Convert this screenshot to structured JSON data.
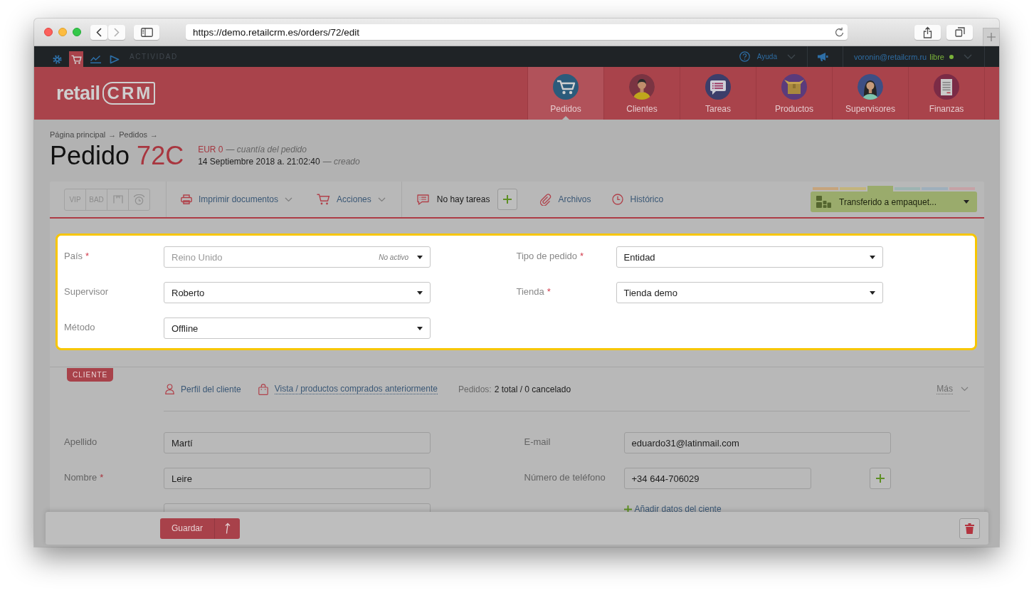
{
  "browser": {
    "url": "https://demo.retailcrm.es/orders/72/edit"
  },
  "topbar": {
    "tools": [
      {
        "kind": "settings",
        "selected": false
      },
      {
        "kind": "cart",
        "selected": true
      },
      {
        "kind": "chart",
        "selected": false
      },
      {
        "kind": "play",
        "selected": false
      }
    ],
    "activity": "ACTIVIDAD",
    "help": "Ayuda",
    "user": "voronin@retailcrm.ru",
    "user_status": "libre",
    "online": true
  },
  "logo": {
    "word": "retail",
    "mark": "CRM"
  },
  "nav": [
    {
      "kind": "cart",
      "label": "Pedidos",
      "selected": true
    },
    {
      "kind": "man",
      "label": "Clientes",
      "selected": false
    },
    {
      "kind": "tasks",
      "label": "Tareas",
      "selected": false
    },
    {
      "kind": "box",
      "label": "Productos",
      "selected": false
    },
    {
      "kind": "woman",
      "label": "Supervisores",
      "selected": false
    },
    {
      "kind": "ledger",
      "label": "Finanzas",
      "selected": false
    }
  ],
  "order": {
    "breadcrumb": {
      "items": [
        "Página principal",
        "Pedidos"
      ],
      "separator": "→"
    },
    "title": "Pedido",
    "number": "72C",
    "amount": "EUR 0",
    "amount_note": "— cuantía del pedido",
    "created": "14 Septiembre 2018 a. 21:02:40",
    "created_note": "— creado"
  },
  "toolbar": {
    "tags": [
      {
        "kind": "text",
        "label": "VIP"
      },
      {
        "kind": "text",
        "label": "BAD"
      },
      {
        "kind": "box"
      },
      {
        "kind": "alarm"
      }
    ],
    "actions": [
      {
        "kind": "print",
        "label": "Imprimir documentos"
      },
      {
        "kind": "cart",
        "label": "Acciones"
      }
    ],
    "tasks": "No hay tareas",
    "links": [
      {
        "kind": "clip",
        "label": "Archivos"
      },
      {
        "kind": "clock",
        "label": "Histórico"
      }
    ],
    "status": {
      "label": "Transferido a empaquet...",
      "groups": [
        {
          "color": "#c6a47c",
          "selected": false
        },
        {
          "color": "#c3b47c",
          "selected": false
        },
        {
          "color": "#9aab6c",
          "selected": true
        },
        {
          "color": "#9db4b2",
          "selected": false
        },
        {
          "color": "#9eafbc",
          "selected": false
        },
        {
          "color": "#c6a2a6",
          "selected": false
        }
      ]
    }
  },
  "panel": {
    "columns": [
      [
        {
          "label": "País",
          "required_mark": "*",
          "value": "Reino Unido",
          "inactive": true,
          "note": "No activo"
        },
        {
          "label": "Supervisor",
          "value": "Roberto",
          "inactive": false
        },
        {
          "label": "Método",
          "value": "Offline",
          "inactive": false
        }
      ],
      [
        {
          "label": "Tipo de pedido",
          "required_mark": "*",
          "value": "Entidad",
          "inactive": false
        },
        {
          "label": "Tienda",
          "required_mark": "*",
          "value": "Tienda demo",
          "inactive": false
        }
      ]
    ]
  },
  "client": {
    "tag": "CLIENTE",
    "links": [
      {
        "kind": "person",
        "label": "Perfil del cliente",
        "dotted": false
      },
      {
        "kind": "bag",
        "label": "Vista / productos comprados anteriormente",
        "dotted": true
      }
    ],
    "orders_label": "Pedidos:",
    "orders_value": "2 total / 0 cancelado",
    "more": "Más",
    "left": [
      {
        "kind": "input",
        "label": "Apellido",
        "value": "Martí"
      },
      {
        "kind": "input",
        "label": "Nombre",
        "required_mark": "*",
        "value": "Leire"
      },
      {
        "kind": "input"
      }
    ],
    "right": [
      {
        "kind": "text",
        "label": "E-mail",
        "value": "eduardo31@latinmail.com"
      },
      {
        "kind": "phone",
        "label": "Número de teléfono",
        "value": "+34 644-706029"
      },
      {
        "kind": "add",
        "label": "Añadir datos del ciente"
      }
    ]
  },
  "footer": {
    "save": "Guardar"
  }
}
